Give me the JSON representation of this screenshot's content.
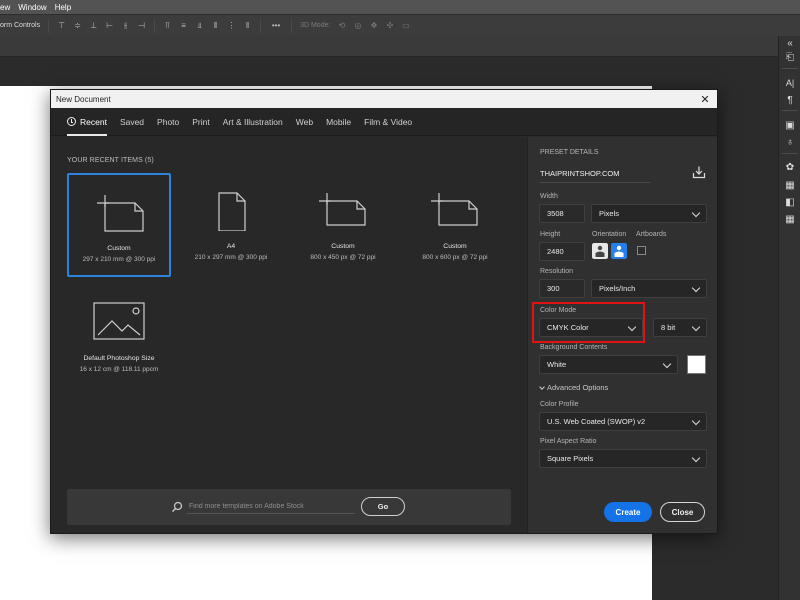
{
  "menubar": {
    "items": [
      "ew",
      "Window",
      "Help"
    ]
  },
  "options_bar": {
    "label": "orm Controls",
    "three_d_mode": "3D Mode:"
  },
  "dialog": {
    "title": "New Document",
    "tabs": [
      {
        "label": "Recent",
        "active": true
      },
      {
        "label": "Saved"
      },
      {
        "label": "Photo"
      },
      {
        "label": "Print"
      },
      {
        "label": "Art & Illustration"
      },
      {
        "label": "Web"
      },
      {
        "label": "Mobile"
      },
      {
        "label": "Film & Video"
      }
    ],
    "recent_heading": "YOUR RECENT ITEMS  (5)",
    "recent_items": [
      {
        "name": "Custom",
        "detail": "297 x 210 mm @ 300 ppi",
        "selected": true
      },
      {
        "name": "A4",
        "detail": "210 x 297 mm @ 300 ppi"
      },
      {
        "name": "Custom",
        "detail": "800 x 450 px @ 72 ppi"
      },
      {
        "name": "Custom",
        "detail": "800 x 600 px @ 72 ppi"
      },
      {
        "name": "Default Photoshop Size",
        "detail": "16 x 12 cm @ 118.11 ppcm"
      }
    ],
    "search": {
      "placeholder": "Find more templates on Adobe Stock",
      "go_label": "Go"
    },
    "preset": {
      "heading": "PRESET DETAILS",
      "name": "THAIPRINTSHOP.COM",
      "width_label": "Width",
      "width_value": "3508",
      "width_unit": "Pixels",
      "height_label": "Height",
      "height_value": "2480",
      "orientation_label": "Orientation",
      "artboards_label": "Artboards",
      "resolution_label": "Resolution",
      "resolution_value": "300",
      "resolution_unit": "Pixels/Inch",
      "color_mode_label": "Color Mode",
      "color_mode_value": "CMYK Color",
      "bit_depth": "8 bit",
      "background_label": "Background Contents",
      "background_value": "White",
      "advanced_label": "Advanced Options",
      "profile_label": "Color Profile",
      "profile_value": "U.S. Web Coated (SWOP) v2",
      "aspect_label": "Pixel Aspect Ratio",
      "aspect_value": "Square Pixels"
    },
    "buttons": {
      "create": "Create",
      "close": "Close"
    }
  },
  "colors": {
    "accent": "#1473e6",
    "selection": "#2b83de",
    "highlight": "#e01313"
  }
}
